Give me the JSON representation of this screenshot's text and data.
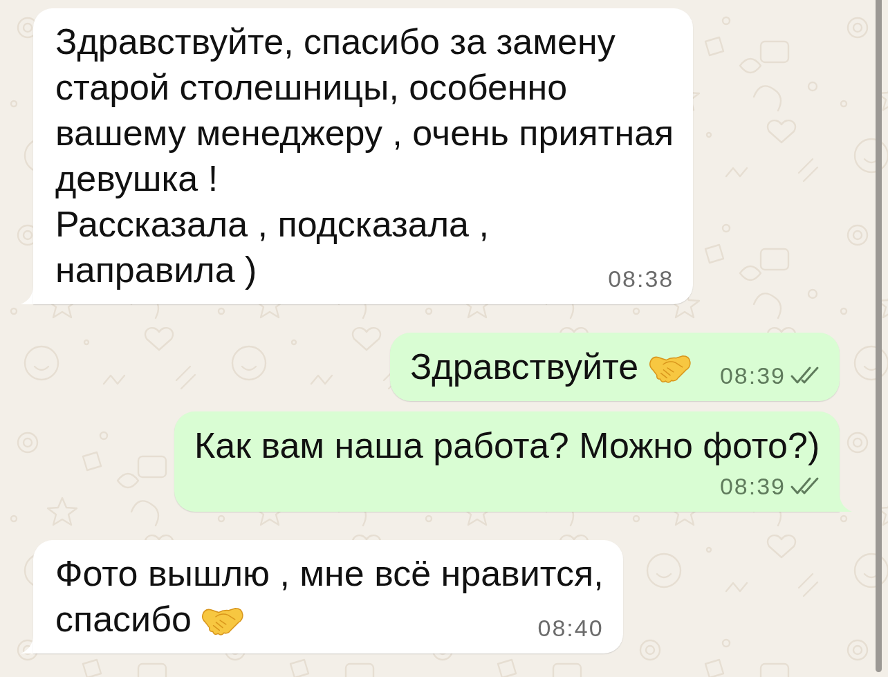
{
  "messages": [
    {
      "kind": "incoming",
      "tail": true,
      "lines": [
        "Здравствуйте, спасибо за замену",
        "старой столешницы, особенно",
        "вашему менеджеру , очень приятная",
        "девушка !",
        "Рассказала , подсказала ,",
        "направила )"
      ],
      "time": "08:38"
    },
    {
      "kind": "outgoing",
      "tail": false,
      "lines": [
        "Здравствуйте"
      ],
      "emoji": true,
      "time": "08:39",
      "read": false
    },
    {
      "kind": "outgoing",
      "tail": true,
      "lines": [
        "Как вам наша работа? Можно фото?)"
      ],
      "time": "08:39",
      "read": false
    },
    {
      "kind": "incoming",
      "tail": true,
      "lines": [
        "Фото вышлю , мне всё нравится,",
        "спасибо"
      ],
      "emoji": true,
      "time": "08:40"
    }
  ]
}
